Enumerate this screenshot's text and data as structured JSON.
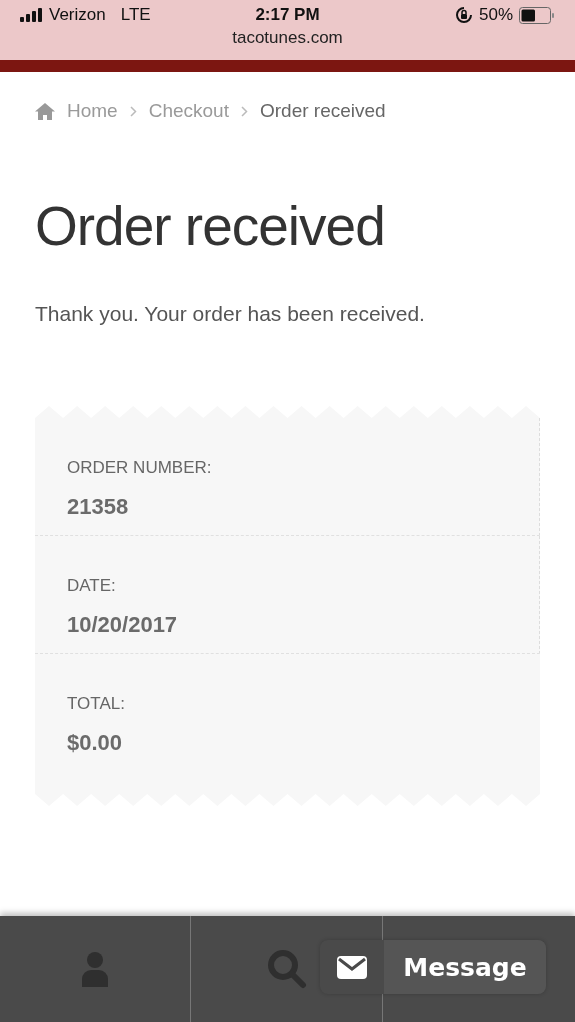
{
  "status_bar": {
    "carrier": "Verizon",
    "network": "LTE",
    "time": "2:17 PM",
    "battery": "50%",
    "url": "tacotunes.com"
  },
  "breadcrumb": [
    {
      "label": "Home",
      "current": false
    },
    {
      "label": "Checkout",
      "current": false
    },
    {
      "label": "Order received",
      "current": true
    }
  ],
  "title": "Order received",
  "message": "Thank you. Your order has been received.",
  "order_overview": [
    {
      "label": "ORDER NUMBER:",
      "value": "21358"
    },
    {
      "label": "DATE:",
      "value": "10/20/2017"
    },
    {
      "label": "TOTAL:",
      "value": "$0.00"
    }
  ],
  "chat_widget": {
    "label": "Message"
  }
}
